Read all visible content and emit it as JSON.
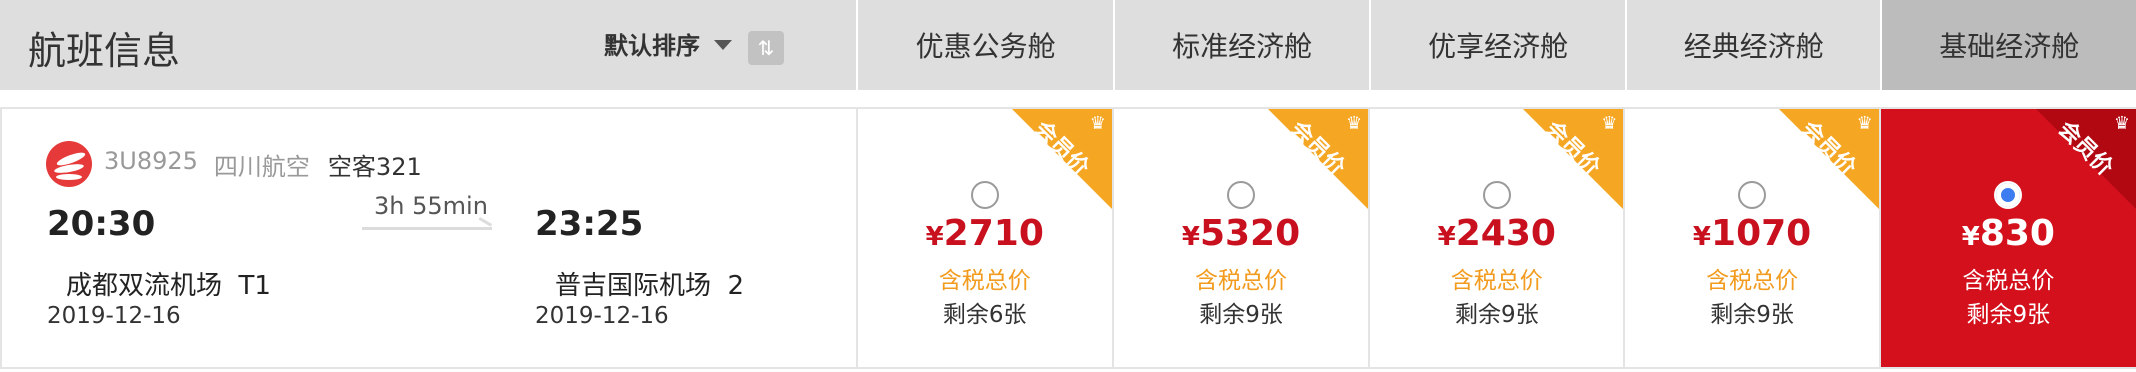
{
  "header": {
    "title": "航班信息",
    "sort_label": "默认排序",
    "sort_toggle_glyph": "⇅",
    "columns": [
      "优惠公务舱",
      "标准经济舱",
      "优享经济舱",
      "经典经济舱",
      "基础经济舱"
    ]
  },
  "flight": {
    "flight_no": "3U8925",
    "airline": "四川航空",
    "aircraft": "空客321",
    "dep_time": "20:30",
    "arr_time": "23:25",
    "duration": "3h 55min",
    "dep_airport": "成都双流机场",
    "dep_terminal": "T1",
    "arr_airport": "普吉国际机场",
    "arr_terminal": "2",
    "dep_date": "2019-12-16",
    "arr_date": "2019-12-16",
    "logo_icon": "sichuan-airlines-logo",
    "logo_color": "#e63a3a"
  },
  "fares": [
    {
      "badge": "会员价",
      "currency": "¥",
      "price": "2710",
      "tax_label": "含税总价",
      "seats": "剩余6张",
      "selected": false
    },
    {
      "badge": "会员价",
      "currency": "¥",
      "price": "5320",
      "tax_label": "含税总价",
      "seats": "剩余9张",
      "selected": false
    },
    {
      "badge": "会员价",
      "currency": "¥",
      "price": "2430",
      "tax_label": "含税总价",
      "seats": "剩余9张",
      "selected": false
    },
    {
      "badge": "会员价",
      "currency": "¥",
      "price": "1070",
      "tax_label": "含税总价",
      "seats": "剩余9张",
      "selected": false
    },
    {
      "badge": "会员价",
      "currency": "¥",
      "price": "830",
      "tax_label": "含税总价",
      "seats": "剩余9张",
      "selected": true
    }
  ],
  "colors": {
    "price_red": "#c9101e",
    "badge_orange": "#f5a623",
    "selected_bg": "#d3101c",
    "header_bg": "#dedede"
  }
}
